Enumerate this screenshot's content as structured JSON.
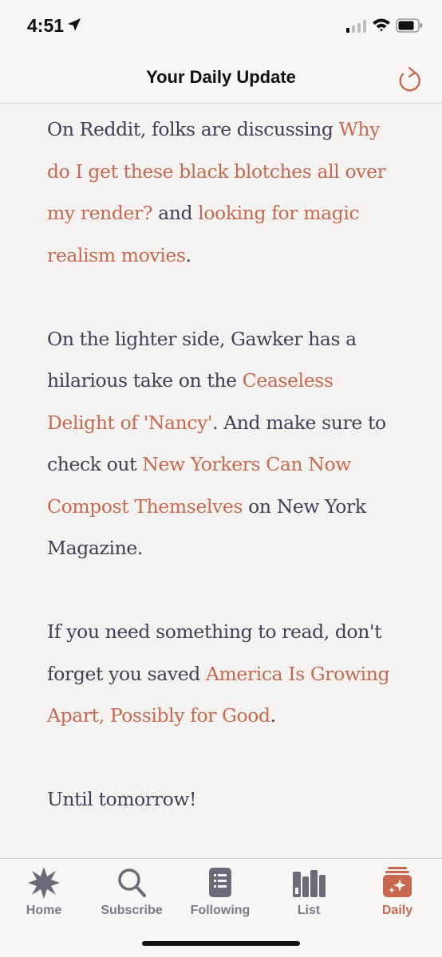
{
  "status_bar": {
    "time": "4:51",
    "icons": [
      "location-arrow-icon",
      "cellular-signal-icon",
      "wifi-icon",
      "battery-icon"
    ]
  },
  "header": {
    "title": "Your Daily Update",
    "refresh_icon": "refresh-icon"
  },
  "content": {
    "p1": {
      "t1": "On Reddit, folks are discussing ",
      "link1": "Why do I get these black blotches all over my render?",
      "t2": " and ",
      "link2": "looking for magic realism movies",
      "t3": "."
    },
    "p2": {
      "t1": "On the lighter side, Gawker has a hilarious take on the ",
      "link1": "Ceaseless Delight of 'Nancy'",
      "t2": ". And make sure to check out ",
      "link2": "New Yorkers Can Now Compost Themselves",
      "t3": " on New York Magazine."
    },
    "p3": {
      "t1": "If you need something to read, don't forget you saved ",
      "link1": "America Is Growing Apart, Possibly for Good",
      "t2": "."
    },
    "p4": {
      "t1": "Until tomorrow!"
    }
  },
  "tabs": [
    {
      "label": "Home",
      "icon": "starburst-icon",
      "active": false
    },
    {
      "label": "Subscribe",
      "icon": "search-icon",
      "active": false
    },
    {
      "label": "Following",
      "icon": "notebook-icon",
      "active": false
    },
    {
      "label": "List",
      "icon": "books-icon",
      "active": false
    },
    {
      "label": "Daily",
      "icon": "sparkle-card-icon",
      "active": true
    }
  ],
  "colors": {
    "accent": "#c8694f",
    "body_text": "#3f3f55",
    "inactive_tab": "#7a7a86",
    "background": "#f4f3f2"
  }
}
